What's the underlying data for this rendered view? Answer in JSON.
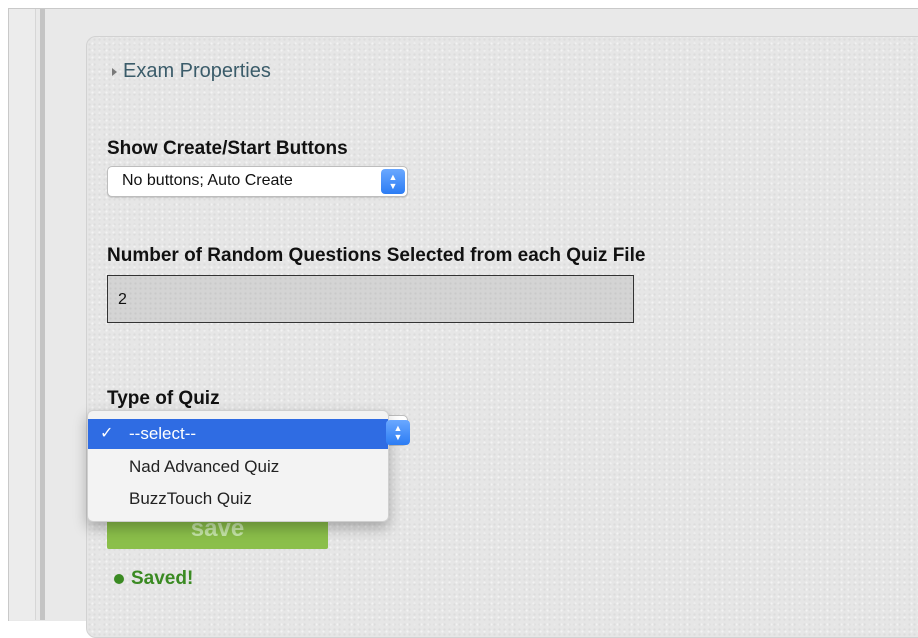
{
  "exam_properties": {
    "header": "Exam Properties"
  },
  "create_start": {
    "label": "Show Create/Start Buttons",
    "selected": "No buttons; Auto Create"
  },
  "random_questions": {
    "label": "Number of Random Questions Selected from each Quiz File",
    "value": "2"
  },
  "quiz_type": {
    "label": "Type of Quiz",
    "options": [
      "--select--",
      "Nad Advanced Quiz",
      "BuzzTouch Quiz"
    ],
    "selected_index": 0,
    "check": "✓"
  },
  "actions": {
    "save_label": "save",
    "saved_status": "Saved!"
  },
  "colors": {
    "accent": "#2f6ce3",
    "save_green": "#8bbf4a",
    "status_green": "#3a8a22",
    "header_link": "#3b5c6a"
  }
}
